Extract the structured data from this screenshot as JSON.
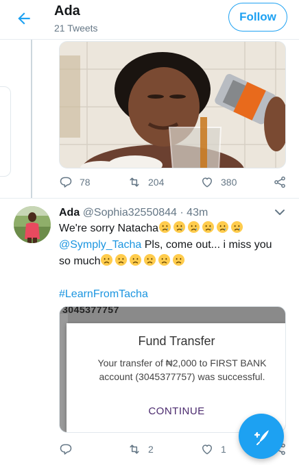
{
  "header": {
    "back_icon": "arrow-left-icon",
    "name": "Ada",
    "tweet_count": "21 Tweets",
    "follow_label": "Follow"
  },
  "tweet1": {
    "media_icon": "photo",
    "actions": {
      "reply_count": "78",
      "retweet_count": "204",
      "like_count": "380"
    }
  },
  "tweet2": {
    "name": "Ada",
    "handle": "@Sophia32550844",
    "separator": "·",
    "time": "43m",
    "line1_text": "We're sorry Natacha",
    "line1_emojis": [
      "crying-face",
      "crying-face",
      "crying-face",
      "crying-face",
      "crying-face",
      "crying-face"
    ],
    "mention": "@Symply_Tacha",
    "line2_text": " Pls, come out... i miss you",
    "line3_text": "so much",
    "line3_emojis": [
      "frowning-face",
      "frowning-face",
      "frowning-face",
      "frowning-face",
      "frowning-face",
      "frowning-face"
    ],
    "hashtag": "#LearnFromTacha",
    "card": {
      "bg_number": "3045377757",
      "dialog_title": "Fund Transfer",
      "dialog_message": "Your transfer of ₦2,000 to FIRST BANK account (3045377757) was successful.",
      "dialog_button": "CONTINUE"
    },
    "actions": {
      "reply_count": "",
      "retweet_count": "2",
      "like_count": "1"
    }
  },
  "fab_icon": "compose-tweet-icon",
  "colors": {
    "accent": "#1da1f2",
    "link": "#1b95e0",
    "muted": "#657786",
    "continue": "#4b2a6e"
  }
}
